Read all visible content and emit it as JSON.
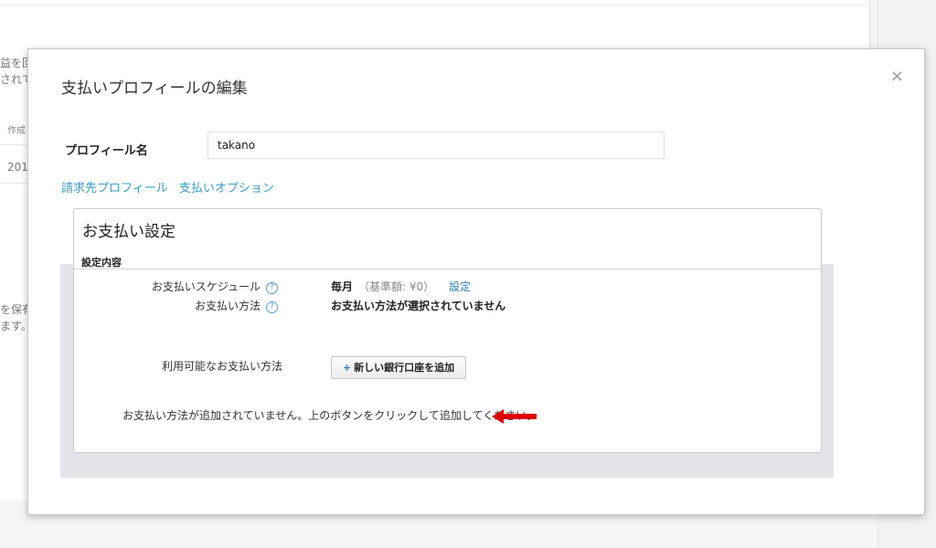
{
  "background": {
    "fragments": [
      "益を回",
      "されて",
      "作成",
      "201",
      "を保有",
      "ます。"
    ]
  },
  "modal": {
    "title": "支払いプロフィールの編集",
    "close_icon": "×",
    "profile_name_label": "プロフィール名",
    "profile_name_value": "takano",
    "tabs": [
      "請求先プロフィール",
      "支払いオプション"
    ],
    "panel": {
      "title": "お支払い設定",
      "subtitle": "設定内容",
      "schedule_label": "お支払いスケジュール",
      "schedule_value": "毎月",
      "schedule_threshold": "（基準額: ¥0）",
      "schedule_link": "設定",
      "method_label": "お支払い方法",
      "method_value": "お支払い方法が選択されていません",
      "available_label": "利用可能なお支払い方法",
      "add_bank_button": "新しい銀行口座を追加",
      "empty_message": "お支払い方法が追加されていません。上のボタンをクリックして追加してください。"
    }
  },
  "icons": {
    "help": "?",
    "plus": "+",
    "arrow": "red-left-arrow"
  },
  "colors": {
    "link": "#3aa0c8",
    "accent_link": "#2a7fc0",
    "arrow": "#e00000"
  }
}
